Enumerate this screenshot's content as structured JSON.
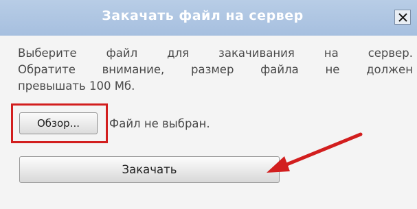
{
  "dialog": {
    "title": "Закачать файл на сервер",
    "close_symbol": "✕",
    "message_lines": [
      "Выберите файл для закачивания на сервер.",
      "Обратите внимание, размер файла не должен",
      "превышать 100 Мб."
    ],
    "browse_label": "Обзор...",
    "file_status": "Файл не выбран.",
    "upload_label": "Закачать"
  },
  "colors": {
    "titlebar": "#a6bfdf",
    "annotation_red": "#d21e1e"
  },
  "icons": {
    "close": "close-icon",
    "arrow": "arrow-annotation-icon"
  }
}
